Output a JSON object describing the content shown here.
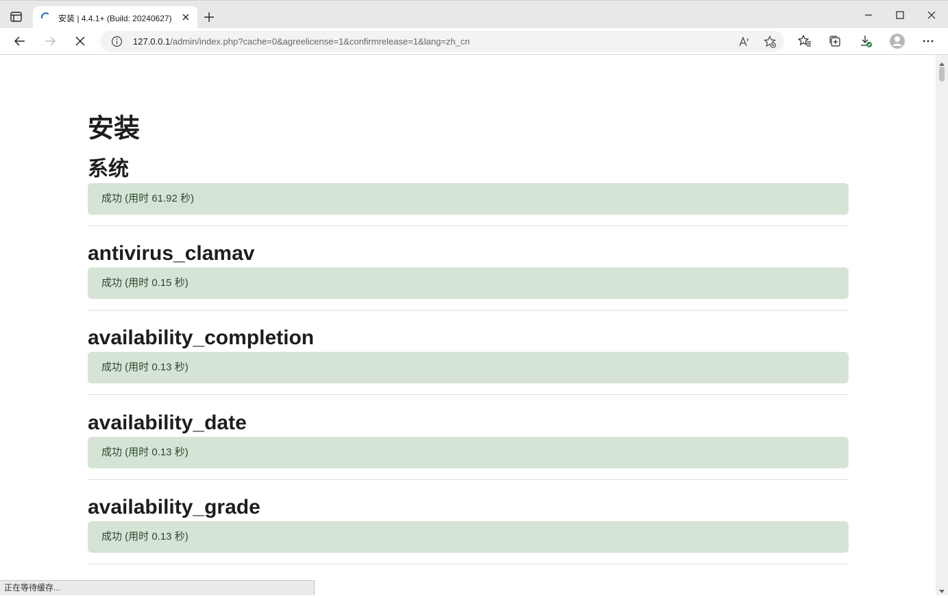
{
  "browser": {
    "tab": {
      "title": "安装 | 4.4.1+ (Build: 20240627)"
    },
    "address": {
      "host": "127.0.0.1",
      "path": "/admin/index.php?cache=0&agreelicense=1&confirmrelease=1&lang=zh_cn"
    },
    "status_text": "正在等待缓存...",
    "colors": {
      "accent": "#0b63c5",
      "success_bg": "#d6e4d6",
      "success_text": "#2c4a2f"
    }
  },
  "page": {
    "title": "安装",
    "sections": [
      {
        "heading": "系统",
        "status": "成功 (用时 61.92 秒)"
      },
      {
        "heading": "antivirus_clamav",
        "status": "成功 (用时 0.15 秒)"
      },
      {
        "heading": "availability_completion",
        "status": "成功 (用时 0.13 秒)"
      },
      {
        "heading": "availability_date",
        "status": "成功 (用时 0.13 秒)"
      },
      {
        "heading": "availability_grade",
        "status": "成功 (用时 0.13 秒)"
      }
    ]
  }
}
